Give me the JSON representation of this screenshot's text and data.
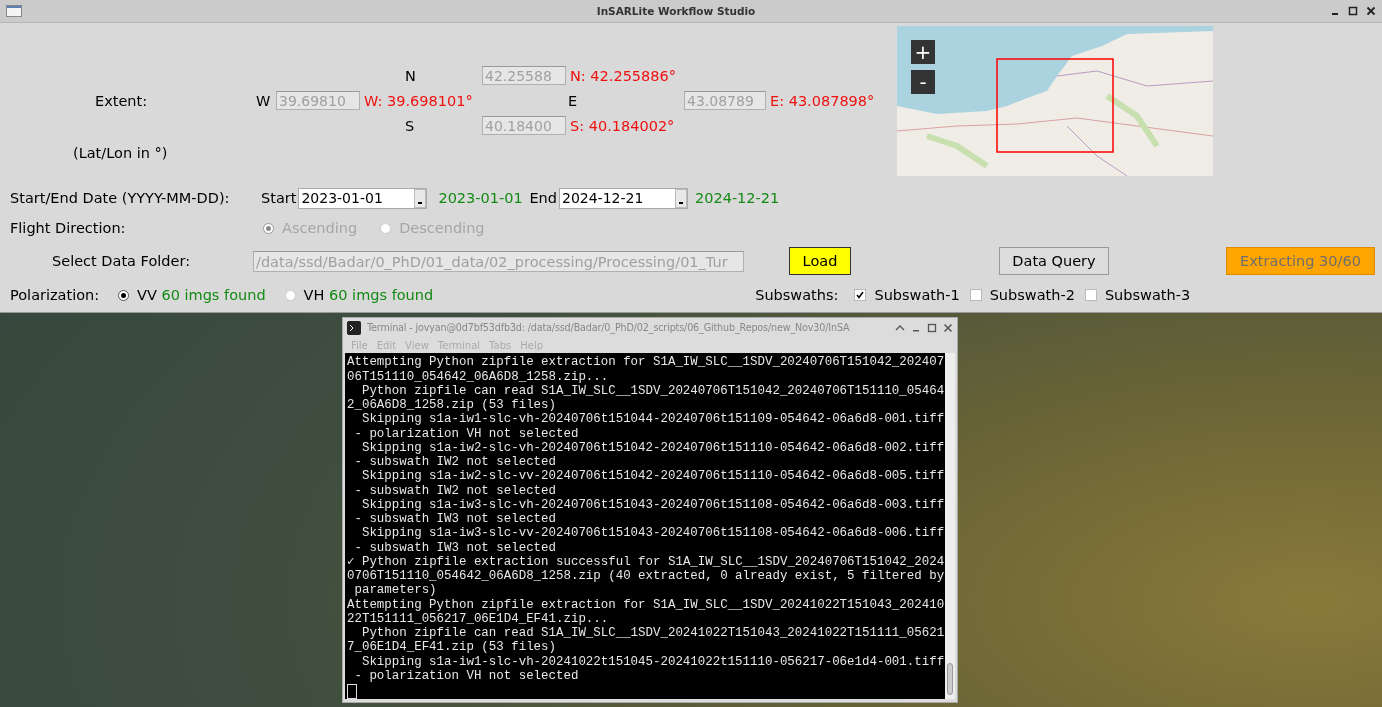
{
  "window": {
    "title": "InSARLite Workflow Studio"
  },
  "extent": {
    "label": "Extent:",
    "note": "(Lat/Lon in °)",
    "bounds": [
      {
        "kind": "north",
        "label": "N",
        "value": "42.25588",
        "readout": "N: 42.255886°"
      },
      {
        "kind": "west",
        "label": "W",
        "value": "39.69810",
        "readout": "W: 39.698101°"
      },
      {
        "kind": "east",
        "label": "E",
        "value": "43.08789",
        "readout": "E: 43.087898°"
      },
      {
        "kind": "south",
        "label": "S",
        "value": "40.18400",
        "readout": "S: 40.184002°"
      }
    ]
  },
  "map": {
    "zoom_in": "+",
    "zoom_out": "-"
  },
  "dates": {
    "label": "Start/End Date (YYYY-MM-DD):",
    "start": {
      "label": "Start",
      "value": "2023-01-01",
      "echo": "2023-01-01"
    },
    "end": {
      "label": "End",
      "value": "2024-12-21",
      "echo": "2024-12-21"
    }
  },
  "flight_direction": {
    "label": "Flight Direction:",
    "disabled": true,
    "options": [
      {
        "label": "Ascending",
        "selected": true
      },
      {
        "label": "Descending",
        "selected": false
      }
    ]
  },
  "data_folder": {
    "label": "Select Data Folder:",
    "value": "/data/ssd/Badar/0_PhD/01_data/02_processing/Processing/01_Tur",
    "disabled": true
  },
  "buttons": [
    {
      "kind": "load",
      "label": "Load",
      "disabled": false
    },
    {
      "kind": "query",
      "label": "Data Query",
      "disabled": false
    },
    {
      "kind": "progress",
      "label": "Extracting 30/60",
      "disabled": true
    }
  ],
  "polarization": {
    "label": "Polarization:",
    "options": [
      {
        "label": "VV",
        "count": "60 imgs found",
        "selected": true
      },
      {
        "label": "VH",
        "count": "60 imgs found",
        "selected": false
      }
    ]
  },
  "subswaths": {
    "label": "Subswaths:",
    "options": [
      {
        "label": "Subswath-1",
        "checked": true
      },
      {
        "label": "Subswath-2",
        "checked": false
      },
      {
        "label": "Subswath-3",
        "checked": false
      }
    ]
  },
  "terminal": {
    "title": "Terminal - jovyan@0d7bf53dfb3d: /data/ssd/Badar/0_PhD/02_scripts/06_Github_Repos/new_Nov30/InSA",
    "menu": [
      "File",
      "Edit",
      "View",
      "Terminal",
      "Tabs",
      "Help"
    ],
    "lines": [
      "Attempting Python zipfile extraction for S1A_IW_SLC__1SDV_20240706T151042_202407",
      "06T151110_054642_06A6D8_1258.zip...",
      "  Python zipfile can read S1A_IW_SLC__1SDV_20240706T151042_20240706T151110_05464",
      "2_06A6D8_1258.zip (53 files)",
      "  Skipping s1a-iw1-slc-vh-20240706t151044-20240706t151109-054642-06a6d8-001.tiff",
      " - polarization VH not selected",
      "  Skipping s1a-iw2-slc-vh-20240706t151042-20240706t151110-054642-06a6d8-002.tiff",
      " - subswath IW2 not selected",
      "  Skipping s1a-iw2-slc-vv-20240706t151042-20240706t151110-054642-06a6d8-005.tiff",
      " - subswath IW2 not selected",
      "  Skipping s1a-iw3-slc-vh-20240706t151043-20240706t151108-054642-06a6d8-003.tiff",
      " - subswath IW3 not selected",
      "  Skipping s1a-iw3-slc-vv-20240706t151043-20240706t151108-054642-06a6d8-006.tiff",
      " - subswath IW3 not selected",
      "✓ Python zipfile extraction successful for S1A_IW_SLC__1SDV_20240706T151042_2024",
      "0706T151110_054642_06A6D8_1258.zip (40 extracted, 0 already exist, 5 filtered by",
      " parameters)",
      "Attempting Python zipfile extraction for S1A_IW_SLC__1SDV_20241022T151043_202410",
      "22T151111_056217_06E1D4_EF41.zip...",
      "  Python zipfile can read S1A_IW_SLC__1SDV_20241022T151043_20241022T151111_05621",
      "7_06E1D4_EF41.zip (53 files)",
      "  Skipping s1a-iw1-slc-vh-20241022t151045-20241022t151110-056217-06e1d4-001.tiff",
      " - polarization VH not selected"
    ]
  }
}
